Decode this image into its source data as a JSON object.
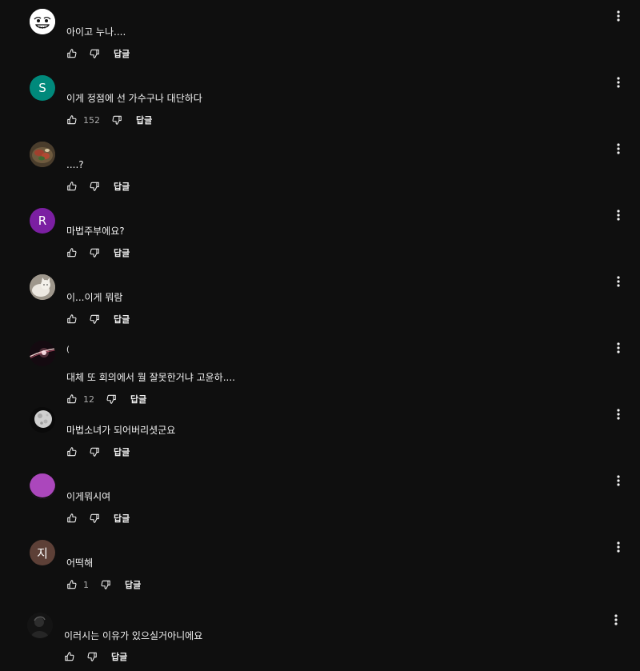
{
  "reply_label": "답글",
  "comments": [
    {
      "text": "아이고 누나....",
      "likes": "",
      "avatar_letter": "",
      "avatar_color": "#ffffff",
      "avatar_icon": "rage-face-icon"
    },
    {
      "text": "이게 정점에 선 가수구나 대단하다",
      "likes": "152",
      "avatar_letter": "S",
      "avatar_color": "#00897b",
      "avatar_icon": ""
    },
    {
      "text": "....?",
      "likes": "",
      "avatar_letter": "",
      "avatar_color": "#5a4a3a",
      "avatar_icon": "food-photo-icon"
    },
    {
      "text": "마법주부에요?",
      "likes": "",
      "avatar_letter": "R",
      "avatar_color": "#7b1fa2",
      "avatar_icon": ""
    },
    {
      "text": "이...이게 뭐람",
      "likes": "",
      "avatar_letter": "",
      "avatar_color": "#b9b2a8",
      "avatar_icon": "white-cat-photo-icon"
    },
    {
      "header": "(",
      "text": "대체 또 회의에서 뭘 잘못한거냐 고윤하....",
      "likes": "12",
      "avatar_letter": "",
      "avatar_color": "#1a1018",
      "avatar_icon": "light-streak-icon"
    },
    {
      "text": "마법소녀가 되어버리셧군요",
      "likes": "",
      "avatar_letter": "",
      "avatar_color": "#111111",
      "avatar_icon": "moon-photo-icon"
    },
    {
      "text": "이게뭐시여",
      "likes": "",
      "avatar_letter": "",
      "avatar_color": "#ab47bc",
      "avatar_icon": "purple-avatar-icon"
    },
    {
      "text": "어떡해",
      "likes": "1",
      "avatar_letter": "지",
      "avatar_color": "#5d4037",
      "avatar_icon": ""
    },
    {
      "text": "이러시는 이유가 있으실거아니에요",
      "likes": "",
      "avatar_letter": "",
      "avatar_color": "#151515",
      "avatar_icon": "dark-figure-icon"
    }
  ]
}
